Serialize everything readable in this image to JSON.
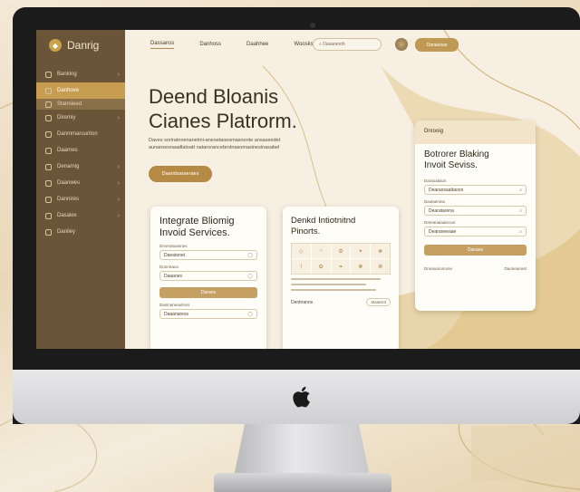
{
  "app": {
    "brand": "Danrig"
  },
  "sidebar": {
    "items": [
      {
        "label": "Banking"
      },
      {
        "label": "Danhove"
      },
      {
        "label": "Stannieed"
      },
      {
        "label": "Diremiy"
      },
      {
        "label": "Danmmaruuriton"
      },
      {
        "label": "Daarnes"
      },
      {
        "label": "Denarnig"
      },
      {
        "label": "Daanwes"
      },
      {
        "label": "Dannires"
      },
      {
        "label": "Dasalex"
      },
      {
        "label": "Daniley"
      }
    ]
  },
  "topnav": {
    "items": [
      "Dassanss",
      "Danhoss",
      "Daahhee",
      "Woosks"
    ],
    "search_placeholder": "Dasaranoh",
    "button_label": "Danaonas"
  },
  "hero": {
    "title_line1": "Deend Bloanis",
    "title_line2": "Cianes Platrorm.",
    "description": "Daves soriratnoenaneimi-anesetaoesmasnonte ansaseedet aunansesnaadlatoatt natarorancebrotnasomasinesinasabel",
    "button_label": "Daaridsaraeraes"
  },
  "card_left": {
    "title_line1": "Integrate Bliomig",
    "title_line2": "Invoid Services.",
    "label1": "Dnomatoannes",
    "field1": "Daeatonet",
    "label2": "Dunnrtaoo",
    "field2": "Daaanes",
    "button_label": "Darans",
    "label3": "Daninaneaotrors",
    "field3": "Daaanaress"
  },
  "card_mid": {
    "title_line1": "Denkd Intiotnitnd",
    "title_line2": "Pinorts.",
    "field": "Dentnanns",
    "chip": "Maaterd"
  },
  "card_right": {
    "header": "Dnrooig",
    "title_line1": "Botrorer Blaking",
    "title_line2": "Invoit Seviss.",
    "label1": "Daraoatiaon",
    "field1": "Dearaosaattaoon",
    "label2": "Daolaenras",
    "field2": "Dearatarena",
    "label3": "Dareanaiaasrous",
    "field3": "Dearaneeaae",
    "button_label": "Danaes",
    "footer_left": "Dnnaoarunorse",
    "footer_right": "Daoneanoet"
  },
  "colors": {
    "accent": "#c09a55",
    "sidebar": "#6b5538",
    "screen_bg": "#f6efe2"
  }
}
